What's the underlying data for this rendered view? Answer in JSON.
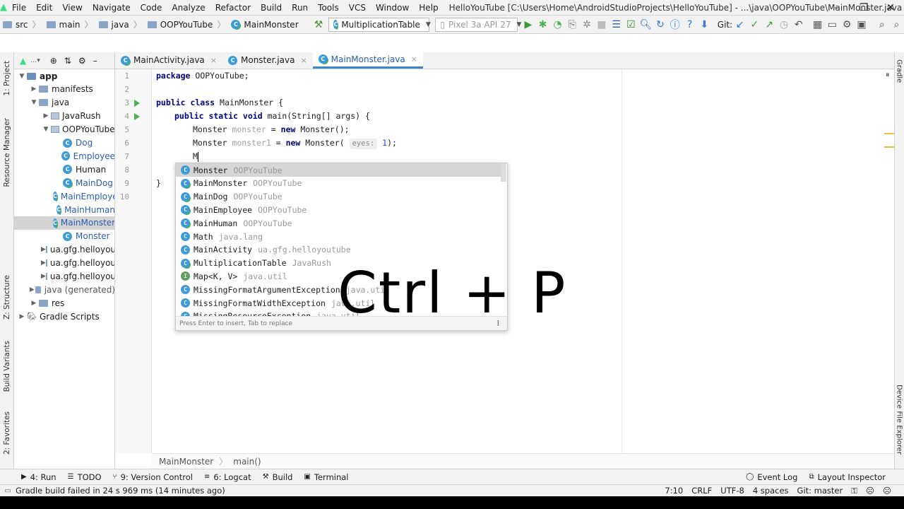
{
  "menubar": {
    "items": [
      "File",
      "Edit",
      "View",
      "Navigate",
      "Code",
      "Analyze",
      "Refactor",
      "Build",
      "Run",
      "Tools",
      "VCS",
      "Window",
      "Help"
    ],
    "window_title": "HelloYouTube [C:\\Users\\Home\\AndroidStudioProjects\\HelloYouTube] - ...\\java\\OOPYouTube\\MainMonster.java [app]"
  },
  "navbar": {
    "breadcrumbs": [
      "src",
      "main",
      "java",
      "OOPYouTube",
      "MainMonster"
    ],
    "run_config": "MultiplicationTable",
    "device": "Pixel 3a API 27",
    "git_label": "Git:"
  },
  "left_tool_tabs": [
    "1: Project",
    "Resource Manager",
    "Z: Structure",
    "Build Variants",
    "2: Favorites"
  ],
  "right_tool_tabs": [
    "Gradle",
    "Device File Explorer"
  ],
  "project_tree": [
    {
      "label": "app",
      "depth": 0,
      "twisty": "▼",
      "icon": "module-folder-icon",
      "style": "bold"
    },
    {
      "label": "manifests",
      "depth": 1,
      "twisty": "▶",
      "icon": "folder-icon",
      "style": ""
    },
    {
      "label": "java",
      "depth": 1,
      "twisty": "▼",
      "icon": "folder-icon",
      "style": ""
    },
    {
      "label": "JavaRush",
      "depth": 2,
      "twisty": "▶",
      "icon": "package-icon",
      "style": ""
    },
    {
      "label": "OOPYouTube",
      "depth": 2,
      "twisty": "▼",
      "icon": "package-icon",
      "style": ""
    },
    {
      "label": "Dog",
      "depth": 3,
      "twisty": "",
      "icon": "class-icon",
      "style": "blue"
    },
    {
      "label": "Employee",
      "depth": 3,
      "twisty": "",
      "icon": "class-icon",
      "style": "blue"
    },
    {
      "label": "Human",
      "depth": 3,
      "twisty": "",
      "icon": "class-icon",
      "style": ""
    },
    {
      "label": "MainDog",
      "depth": 3,
      "twisty": "",
      "icon": "runnable-class-icon",
      "style": "blue"
    },
    {
      "label": "MainEmploye",
      "depth": 3,
      "twisty": "",
      "icon": "runnable-class-icon",
      "style": "blue"
    },
    {
      "label": "MainHuman",
      "depth": 3,
      "twisty": "",
      "icon": "runnable-class-icon",
      "style": "blue"
    },
    {
      "label": "MainMonster",
      "depth": 3,
      "twisty": "",
      "icon": "runnable-class-icon",
      "style": "blue",
      "selected": true
    },
    {
      "label": "Monster",
      "depth": 3,
      "twisty": "",
      "icon": "class-icon",
      "style": "blue"
    },
    {
      "label": "ua.gfg.helloyoutu",
      "depth": 2,
      "twisty": "▶",
      "icon": "package-icon",
      "style": ""
    },
    {
      "label": "ua.gfg.helloyoutu",
      "depth": 2,
      "twisty": "▶",
      "icon": "package-icon",
      "style": ""
    },
    {
      "label": "ua.gfg.helloyoutu",
      "depth": 2,
      "twisty": "▶",
      "icon": "package-icon",
      "style": ""
    },
    {
      "label": "java (generated)",
      "depth": 1,
      "twisty": "▶",
      "icon": "folder-icon",
      "style": "dim-suffix"
    },
    {
      "label": "res",
      "depth": 1,
      "twisty": "▶",
      "icon": "folder-icon",
      "style": ""
    },
    {
      "label": "Gradle Scripts",
      "depth": 0,
      "twisty": "▶",
      "icon": "gradle-icon",
      "style": ""
    }
  ],
  "editor_tabs": [
    {
      "label": "MainActivity.java",
      "active": false
    },
    {
      "label": "Monster.java",
      "active": false
    },
    {
      "label": "MainMonster.java",
      "active": true
    }
  ],
  "code": {
    "line_numbers": [
      "1",
      "2",
      "3",
      "4",
      "5",
      "6",
      "7",
      "8",
      "9",
      "10"
    ],
    "run_marker_lines": [
      3,
      4
    ],
    "lines": {
      "l1_kw": "package",
      "l1_rest": " OOPYouTube;",
      "l3_kw": "public class",
      "l3_rest": " MainMonster {",
      "l4_kw": "public static void",
      "l4_rest": " main(String[] args) {",
      "l5_type": "Monster ",
      "l5_var": "monster",
      "l5_eq": " = ",
      "l5_kw": "new",
      "l5_rest": " Monster();",
      "l6_type": "Monster ",
      "l6_var": "monster1",
      "l6_eq": " = ",
      "l6_kw": "new",
      "l6_call": " Monster( ",
      "l6_hint": "eyes:",
      "l6_num": "1",
      "l6_end": ");",
      "l7_typed": "M",
      "l8": "}",
      "l9": "}"
    }
  },
  "completion": {
    "items": [
      {
        "name": "Monster",
        "loc": "OOPYouTube",
        "icon": "class-icon"
      },
      {
        "name": "MainMonster",
        "loc": "OOPYouTube",
        "icon": "runnable-class-icon"
      },
      {
        "name": "MainDog",
        "loc": "OOPYouTube",
        "icon": "runnable-class-icon"
      },
      {
        "name": "MainEmployee",
        "loc": "OOPYouTube",
        "icon": "runnable-class-icon"
      },
      {
        "name": "MainHuman",
        "loc": "OOPYouTube",
        "icon": "runnable-class-icon"
      },
      {
        "name": "Math",
        "loc": "java.lang",
        "icon": "class-icon"
      },
      {
        "name": "MainActivity",
        "loc": "ua.gfg.helloyoutube",
        "icon": "class-icon"
      },
      {
        "name": "MultiplicationTable",
        "loc": "JavaRush",
        "icon": "runnable-class-icon"
      },
      {
        "name": "Map<K, V>",
        "loc": "java.util",
        "icon": "interface-icon"
      },
      {
        "name": "MissingFormatArgumentException",
        "loc": "java.util",
        "icon": "class-icon"
      },
      {
        "name": "MissingFormatWidthException",
        "loc": "java.util",
        "icon": "class-icon"
      },
      {
        "name": "MissingResourceException",
        "loc": "java.util",
        "icon": "class-icon"
      }
    ],
    "footer": "Press Enter to insert, Tab to replace"
  },
  "overlay_text": "Ctrl + P",
  "editor_breadcrumb": [
    "MainMonster",
    "main()"
  ],
  "tool_windows": {
    "left": [
      {
        "label": "4: Run",
        "icon": "run-icon"
      },
      {
        "label": "TODO",
        "icon": "todo-icon"
      },
      {
        "label": "9: Version Control",
        "icon": "vcs-icon"
      },
      {
        "label": "6: Logcat",
        "icon": "logcat-icon"
      },
      {
        "label": "Build",
        "icon": "hammer-icon"
      },
      {
        "label": "Terminal",
        "icon": "terminal-icon"
      }
    ],
    "right": [
      {
        "label": "Event Log",
        "icon": "event-log-icon"
      },
      {
        "label": "Layout Inspector",
        "icon": "layout-inspector-icon"
      }
    ]
  },
  "status": {
    "message": "Gradle build failed in 24 s 969 ms (14 minutes ago)",
    "position": "7:10",
    "line_sep": "CRLF",
    "encoding": "UTF-8",
    "indent": "4 spaces",
    "git_branch": "Git: master"
  }
}
